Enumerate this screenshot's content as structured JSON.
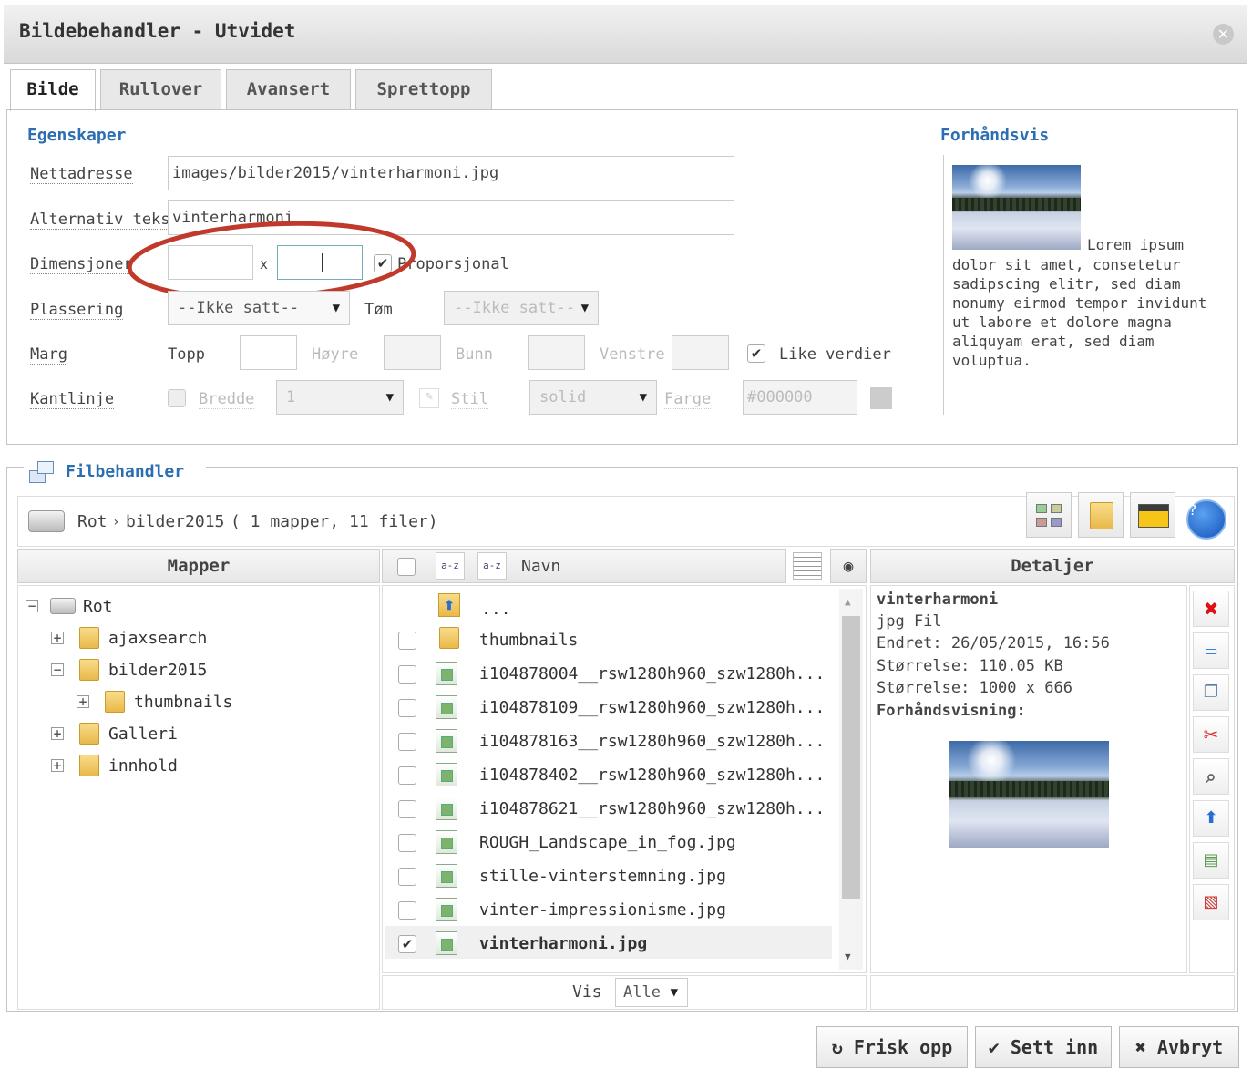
{
  "window": {
    "title": "Bildebehandler - Utvidet"
  },
  "tabs": [
    "Bilde",
    "Rullover",
    "Avansert",
    "Sprettopp"
  ],
  "properties": {
    "legend": "Egenskaper",
    "url_label": "Nettadresse",
    "url_value": "images/bilder2015/vinterharmoni.jpg",
    "alt_label": "Alternativ tekst",
    "alt_value": "vinterharmoni",
    "dim_label": "Dimensjoner",
    "dim_x": "x",
    "proportional_label": "Proporsjonal",
    "align_label": "Plassering",
    "align_value": "--Ikke satt--",
    "clear_label": "Tøm",
    "clear_value": "--Ikke satt--",
    "margin_label": "Marg",
    "top_label": "Topp",
    "right_label": "Høyre",
    "bottom_label": "Bunn",
    "left_label": "Venstre",
    "equal_label": "Like verdier",
    "border_label": "Kantlinje",
    "width_label": "Bredde",
    "width_value": "1",
    "style_label": "Stil",
    "style_value": "solid",
    "color_label": "Farge",
    "color_value": "#000000"
  },
  "preview": {
    "legend": "Forhåndsvis",
    "lorem": "Lorem ipsum",
    "text": "dolor sit amet, consetetur sadipscing elitr, sed diam nonumy eirmod tempor invidunt ut labore et dolore magna aliquyam erat, sed diam voluptua."
  },
  "filemanager": {
    "legend": "Filbehandler",
    "breadcrumb_root": "Rot",
    "breadcrumb_sep": "›",
    "breadcrumb_folder": "bilder2015",
    "summary": "( 1 mapper, 11 filer)",
    "folders_header": "Mapper",
    "name_header": "Navn",
    "details_header": "Detaljer",
    "tree": [
      {
        "label": "Rot"
      },
      {
        "label": "ajaxsearch"
      },
      {
        "label": "bilder2015"
      },
      {
        "label": "thumbnails"
      },
      {
        "label": "Galleri"
      },
      {
        "label": "innhold"
      }
    ],
    "up_label": "...",
    "files": [
      "thumbnails",
      "i104878004__rsw1280h960_szw1280h...",
      "i104878109__rsw1280h960_szw1280h...",
      "i104878163__rsw1280h960_szw1280h...",
      "i104878402__rsw1280h960_szw1280h...",
      "i104878621__rsw1280h960_szw1280h...",
      "ROUGH_Landscape_in_fog.jpg",
      "stille-vinterstemning.jpg",
      "vinter-impressionisme.jpg",
      "vinterharmoni.jpg"
    ],
    "selected_file": "vinterharmoni.jpg",
    "view_label": "Vis",
    "view_value": "Alle",
    "details": {
      "name": "vinterharmoni",
      "type": "jpg Fil",
      "modified": "Endret: 26/05/2015, 16:56",
      "size": "Størrelse: 110.05 KB",
      "dims": "Størrelse: 1000 x 666",
      "preview_label": "Forhåndsvisning:"
    }
  },
  "buttons": {
    "refresh": "Frisk opp",
    "insert": "Sett inn",
    "cancel": "Avbryt"
  },
  "colors": {
    "accent": "#2b6eb2",
    "annotation": "#c0392b"
  }
}
